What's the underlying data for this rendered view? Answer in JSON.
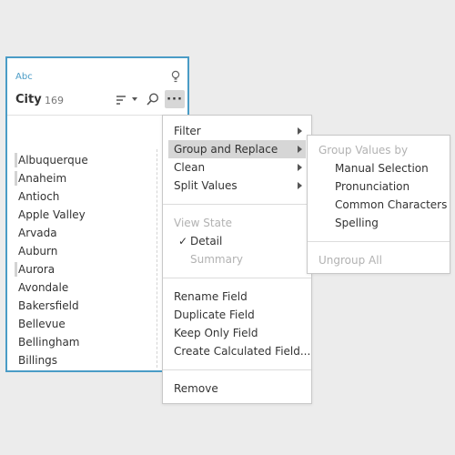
{
  "card": {
    "type_label": "Abc",
    "field_name": "City",
    "field_count": "169",
    "more_label": "···",
    "values": [
      "Albuquerque",
      "Anaheim",
      "Antioch",
      "Apple Valley",
      "Arvada",
      "Auburn",
      "Aurora",
      "Avondale",
      "Bakersfield",
      "Bellevue",
      "Bellingham",
      "Billings"
    ]
  },
  "menu": {
    "filter": "Filter",
    "group_replace": "Group and Replace",
    "clean": "Clean",
    "split_values": "Split Values",
    "view_state": "View State",
    "check_mark": "✓",
    "detail": "Detail",
    "summary": "Summary",
    "rename": "Rename Field",
    "duplicate": "Duplicate Field",
    "keep_only": "Keep Only Field",
    "create_calc": "Create Calculated Field...",
    "remove": "Remove"
  },
  "submenu": {
    "group_values_by": "Group Values by",
    "manual": "Manual Selection",
    "pronunciation": "Pronunciation",
    "common_chars": "Common Characters",
    "spelling": "Spelling",
    "ungroup_all": "Ungroup All"
  }
}
